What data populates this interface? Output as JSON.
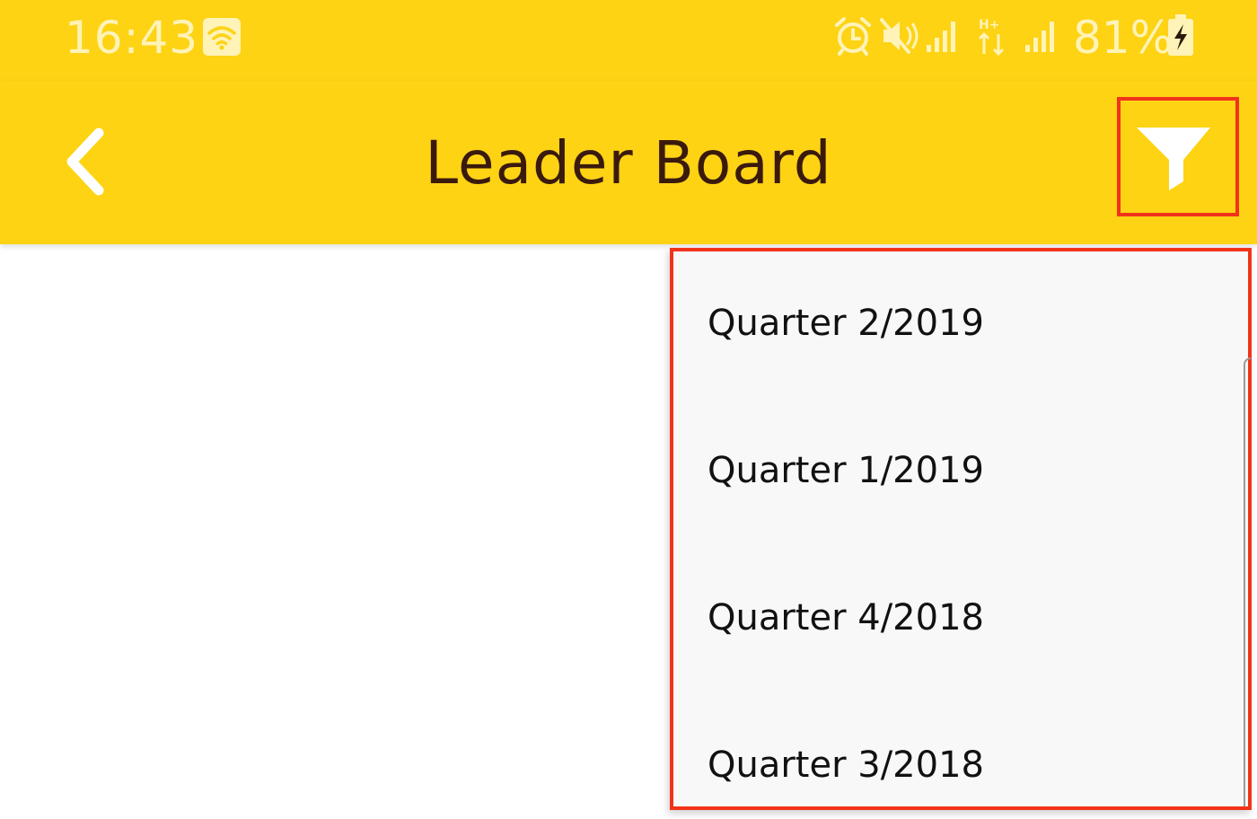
{
  "status_bar": {
    "time": "16:43",
    "battery_percent": "81%",
    "icons": [
      "wifi-icon",
      "alarm-icon",
      "mute-icon",
      "signal-icon",
      "hplus-data-icon",
      "signal-icon",
      "battery-charging-icon"
    ],
    "background_color": "#FDD314",
    "icon_color": "#FFF3B8"
  },
  "app_bar": {
    "title": "Leader Board",
    "back_icon": "chevron-left-icon",
    "filter_icon": "filter-funnel-icon",
    "background_color": "#FDD314",
    "title_color": "#3A1A0C",
    "highlight_color": "#F2331B"
  },
  "filter_menu": {
    "items": [
      {
        "label": "Quarter 2/2019"
      },
      {
        "label": "Quarter 1/2019"
      },
      {
        "label": "Quarter 4/2018"
      },
      {
        "label": "Quarter 3/2018"
      }
    ],
    "background_color": "#F8F8F8"
  }
}
